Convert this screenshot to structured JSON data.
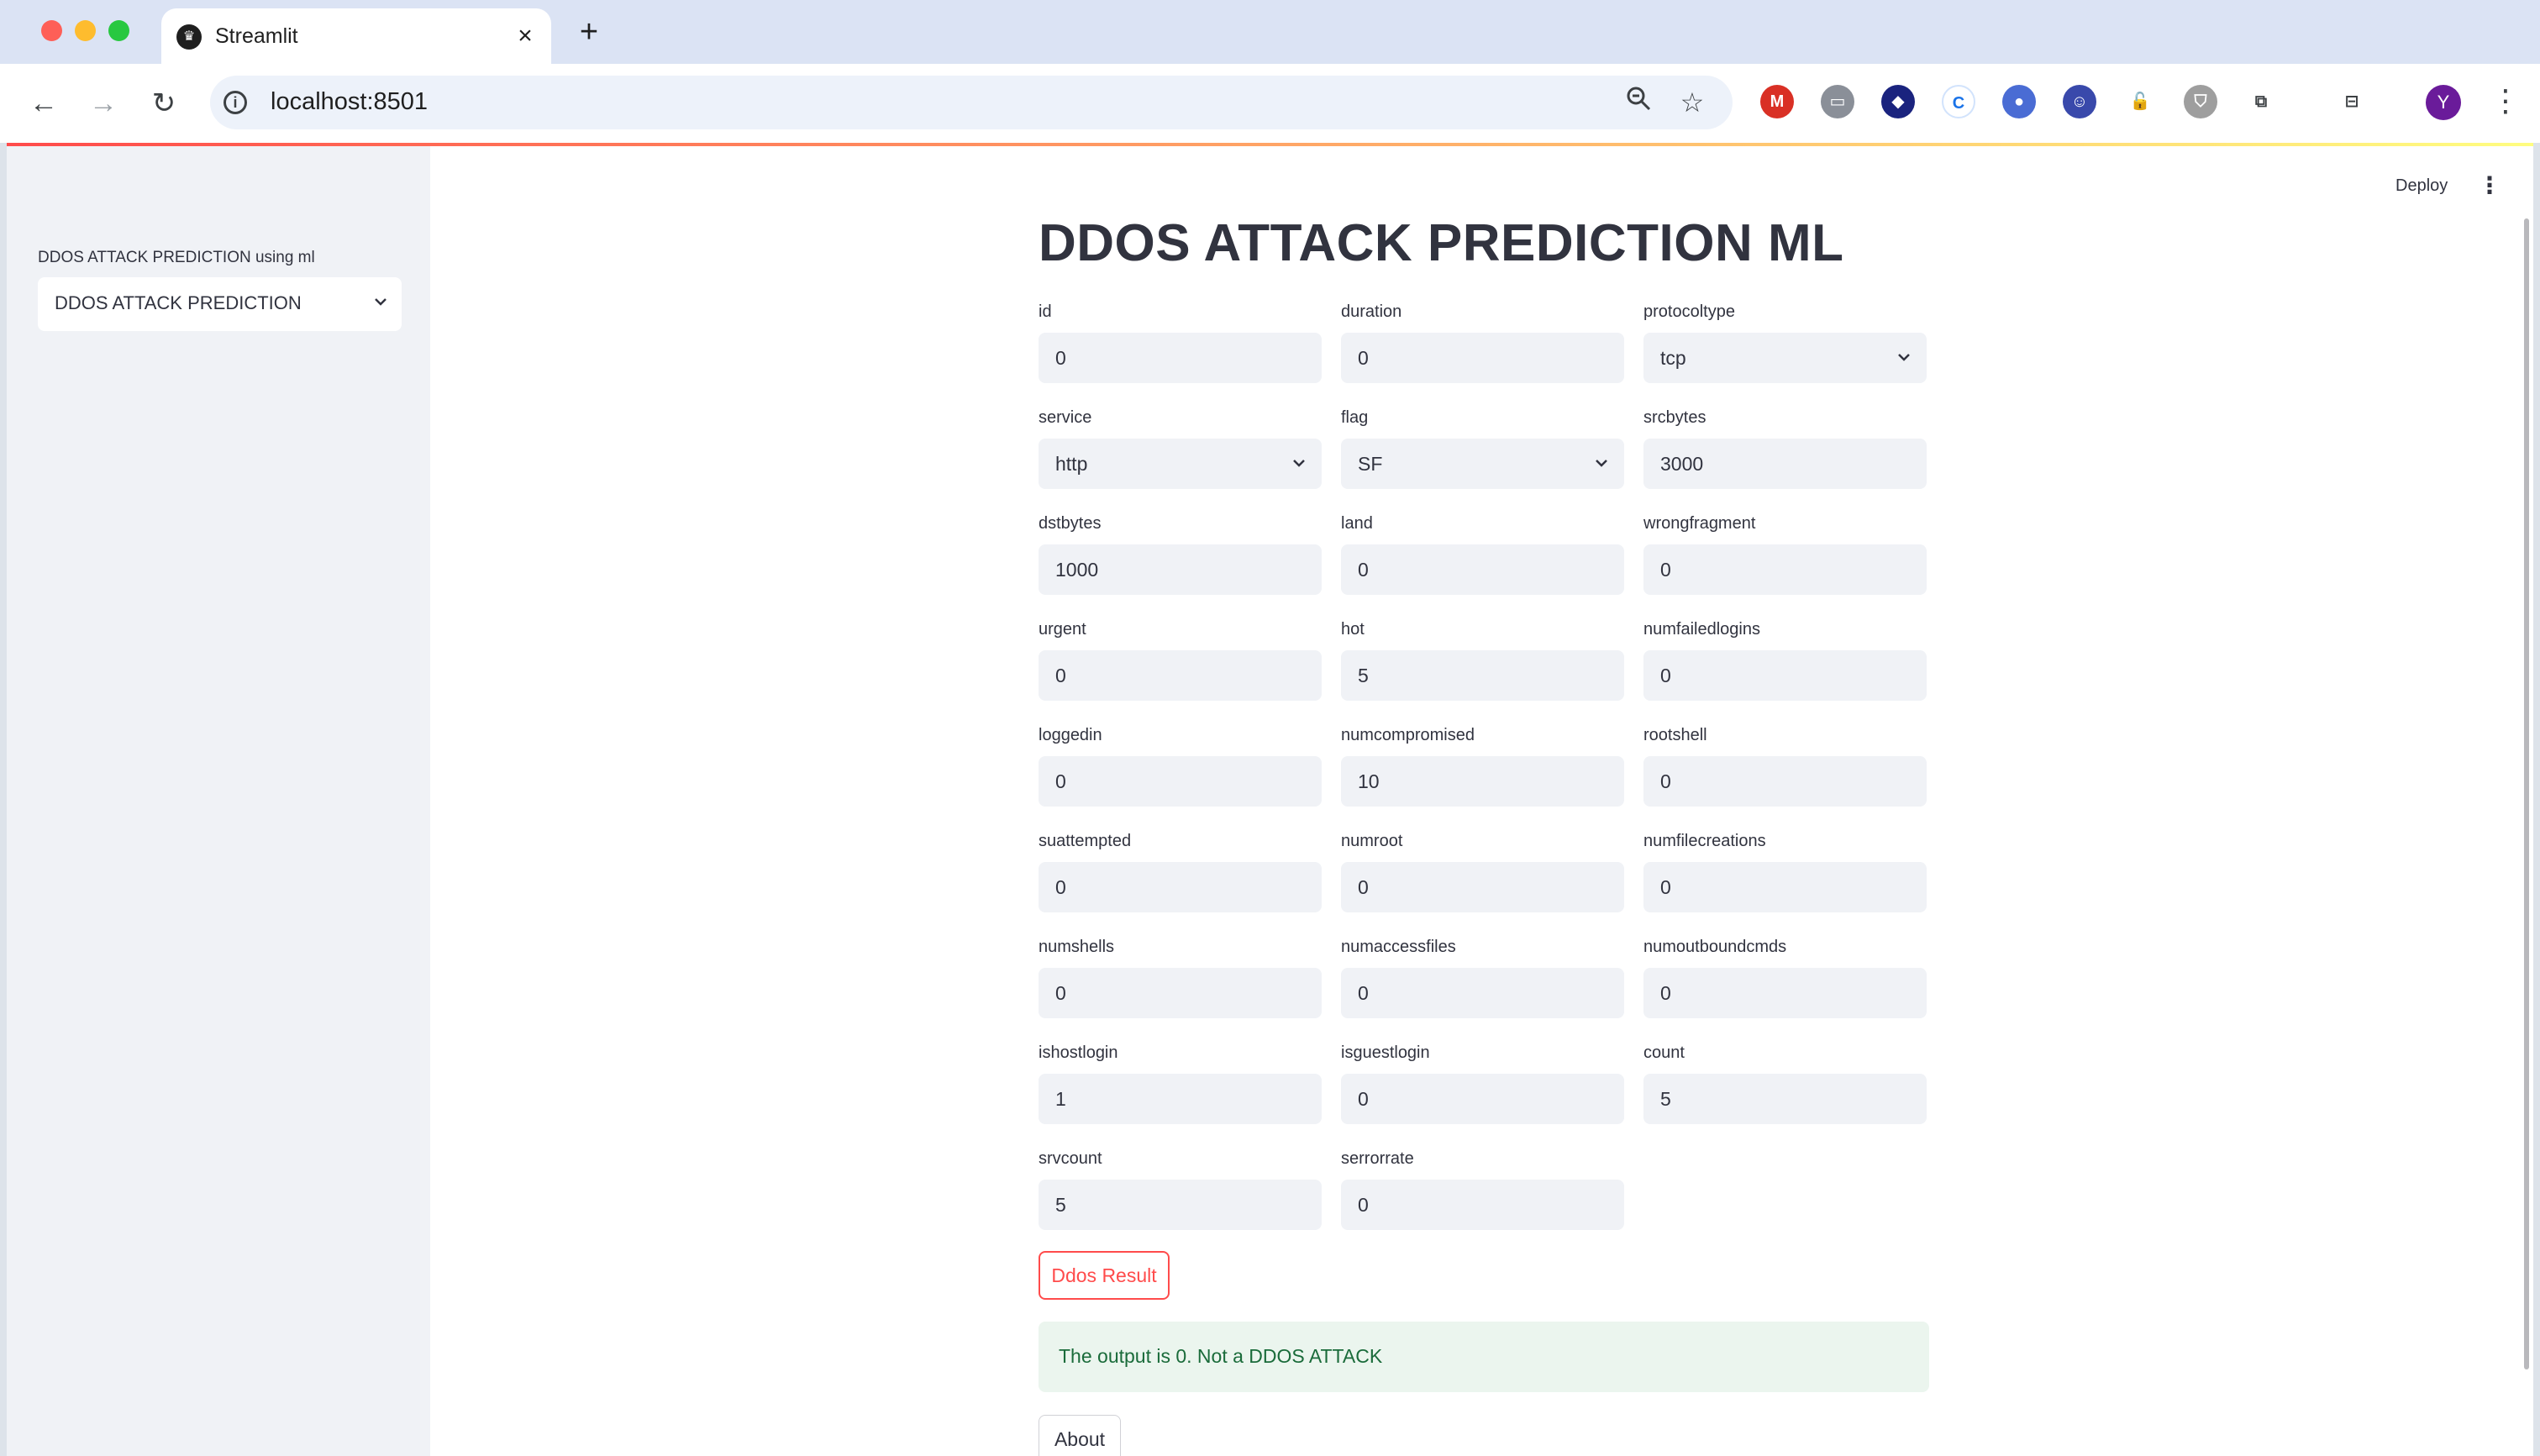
{
  "browser": {
    "tab_title": "Streamlit",
    "url": "localhost:8501",
    "profile_initial": "Y"
  },
  "colors": {
    "primary": "#ff4b4b",
    "success_bg": "#ebf5ee",
    "success_text": "#1a6b3a",
    "sidebar_bg": "#f0f2f6"
  },
  "sidebar": {
    "label": "DDOS ATTACK PREDICTION using ml",
    "selected": "DDOS ATTACK PREDICTION"
  },
  "header": {
    "deploy_label": "Deploy"
  },
  "main": {
    "title": "DDOS ATTACK PREDICTION ML",
    "fields": {
      "id": {
        "label": "id",
        "value": "0"
      },
      "duration": {
        "label": "duration",
        "value": "0"
      },
      "protocoltype": {
        "label": "protocoltype",
        "value": "tcp"
      },
      "service": {
        "label": "service",
        "value": "http"
      },
      "flag": {
        "label": "flag",
        "value": "SF"
      },
      "srcbytes": {
        "label": "srcbytes",
        "value": "3000"
      },
      "dstbytes": {
        "label": "dstbytes",
        "value": "1000"
      },
      "land": {
        "label": "land",
        "value": "0"
      },
      "wrongfragment": {
        "label": "wrongfragment",
        "value": "0"
      },
      "urgent": {
        "label": "urgent",
        "value": "0"
      },
      "hot": {
        "label": "hot",
        "value": "5"
      },
      "numfailedlogins": {
        "label": "numfailedlogins",
        "value": "0"
      },
      "loggedin": {
        "label": "loggedin",
        "value": "0"
      },
      "numcompromised": {
        "label": "numcompromised",
        "value": "10"
      },
      "rootshell": {
        "label": "rootshell",
        "value": "0"
      },
      "suattempted": {
        "label": "suattempted",
        "value": "0"
      },
      "numroot": {
        "label": "numroot",
        "value": "0"
      },
      "numfilecreations": {
        "label": "numfilecreations",
        "value": "0"
      },
      "numshells": {
        "label": "numshells",
        "value": "0"
      },
      "numaccessfiles": {
        "label": "numaccessfiles",
        "value": "0"
      },
      "numoutboundcmds": {
        "label": "numoutboundcmds",
        "value": "0"
      },
      "ishostlogin": {
        "label": "ishostlogin",
        "value": "1"
      },
      "isguestlogin": {
        "label": "isguestlogin",
        "value": "0"
      },
      "count": {
        "label": "count",
        "value": "5"
      },
      "srvcount": {
        "label": "srvcount",
        "value": "5"
      },
      "serrorrate": {
        "label": "serrorrate",
        "value": "0"
      }
    },
    "result_button": "Ddos Result",
    "result_message": "The output is 0. Not a DDOS ATTACK",
    "about_button": "About"
  }
}
